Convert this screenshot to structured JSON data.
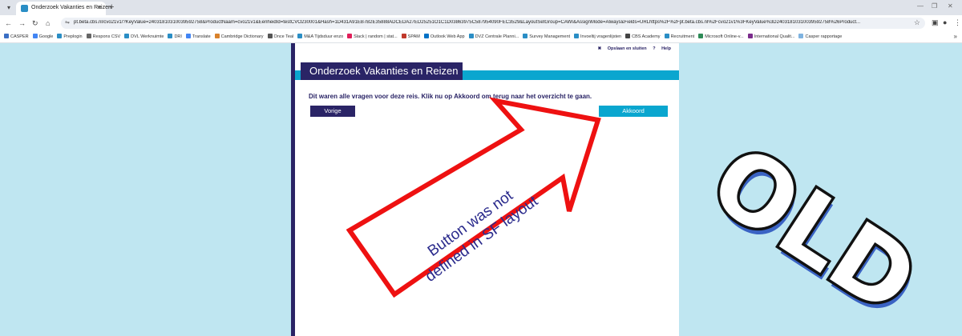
{
  "browser": {
    "tab_title": "Onderzoek Vakanties en Reizen",
    "url": "pt.beta.cbs.nl/cvo21v1/?KeyValue=24031810310039592758&ProductNaam=cvo21v1&EenheidId=testCVO230001&Hash=1D431A91EB7B2E35888ADCEDA27ED25251O1C1D03863975C587954090FEC3529&LayoutSetGroup=CAWI&AssignMode=Always&Fields=URLhttps%2F%2Fpt.beta.cbs.nl%2Fcvo21v1%3FKeyValue%3D24031810310039592758%26Product...",
    "bookmarks": [
      {
        "label": "CASPER",
        "color": "#3a6fc4"
      },
      {
        "label": "Google",
        "color": "#4285f4"
      },
      {
        "label": "Preplogin",
        "color": "#2a8ec5"
      },
      {
        "label": "Respons CSV",
        "color": "#666666"
      },
      {
        "label": "DVL Werknuimte",
        "color": "#2a8ec5"
      },
      {
        "label": "DRI",
        "color": "#2a8ec5"
      },
      {
        "label": "Translate",
        "color": "#4285f4"
      },
      {
        "label": "Cambridge Dictionary",
        "color": "#d9822b"
      },
      {
        "label": "Once Teal",
        "color": "#555555"
      },
      {
        "label": "M&A Tijdsduur enzo",
        "color": "#2a8ec5"
      },
      {
        "label": "Slack | random | stat...",
        "color": "#e01e5a"
      },
      {
        "label": "SPAM",
        "color": "#c0392b"
      },
      {
        "label": "Outlook Web App",
        "color": "#0072c6"
      },
      {
        "label": "DVZ Centrale Planni...",
        "color": "#2a8ec5"
      },
      {
        "label": "Survey Management",
        "color": "#2a8ec5"
      },
      {
        "label": "Invoeltij vragenlijsten",
        "color": "#2a8ec5"
      },
      {
        "label": "CBS Academy",
        "color": "#444444"
      },
      {
        "label": "Recruitment",
        "color": "#2a8ec5"
      },
      {
        "label": "Microsoft Online-v...",
        "color": "#2e8b57"
      },
      {
        "label": "International Qualit...",
        "color": "#7b2c8c"
      },
      {
        "label": "Casper rapportage",
        "color": "#7fb3e0"
      }
    ]
  },
  "survey": {
    "link_save": "Opslaan en sluiten",
    "link_help": "Help",
    "title": "Onderzoek Vakanties en Reizen",
    "instruction": "Dit waren alle vragen voor deze reis. Klik nu op Akkoord om terug naar het overzicht te gaan.",
    "btn_prev": "Vorige",
    "btn_next": "Akkoord"
  },
  "annotation": {
    "callout_line1": "Button was not",
    "callout_line2": "defined in SF layout",
    "stamp": "OLD"
  },
  "colors": {
    "background": "#bfe6f1",
    "navy": "#2a2466",
    "accent": "#0aa6cf",
    "callout_red": "#ee1111"
  }
}
